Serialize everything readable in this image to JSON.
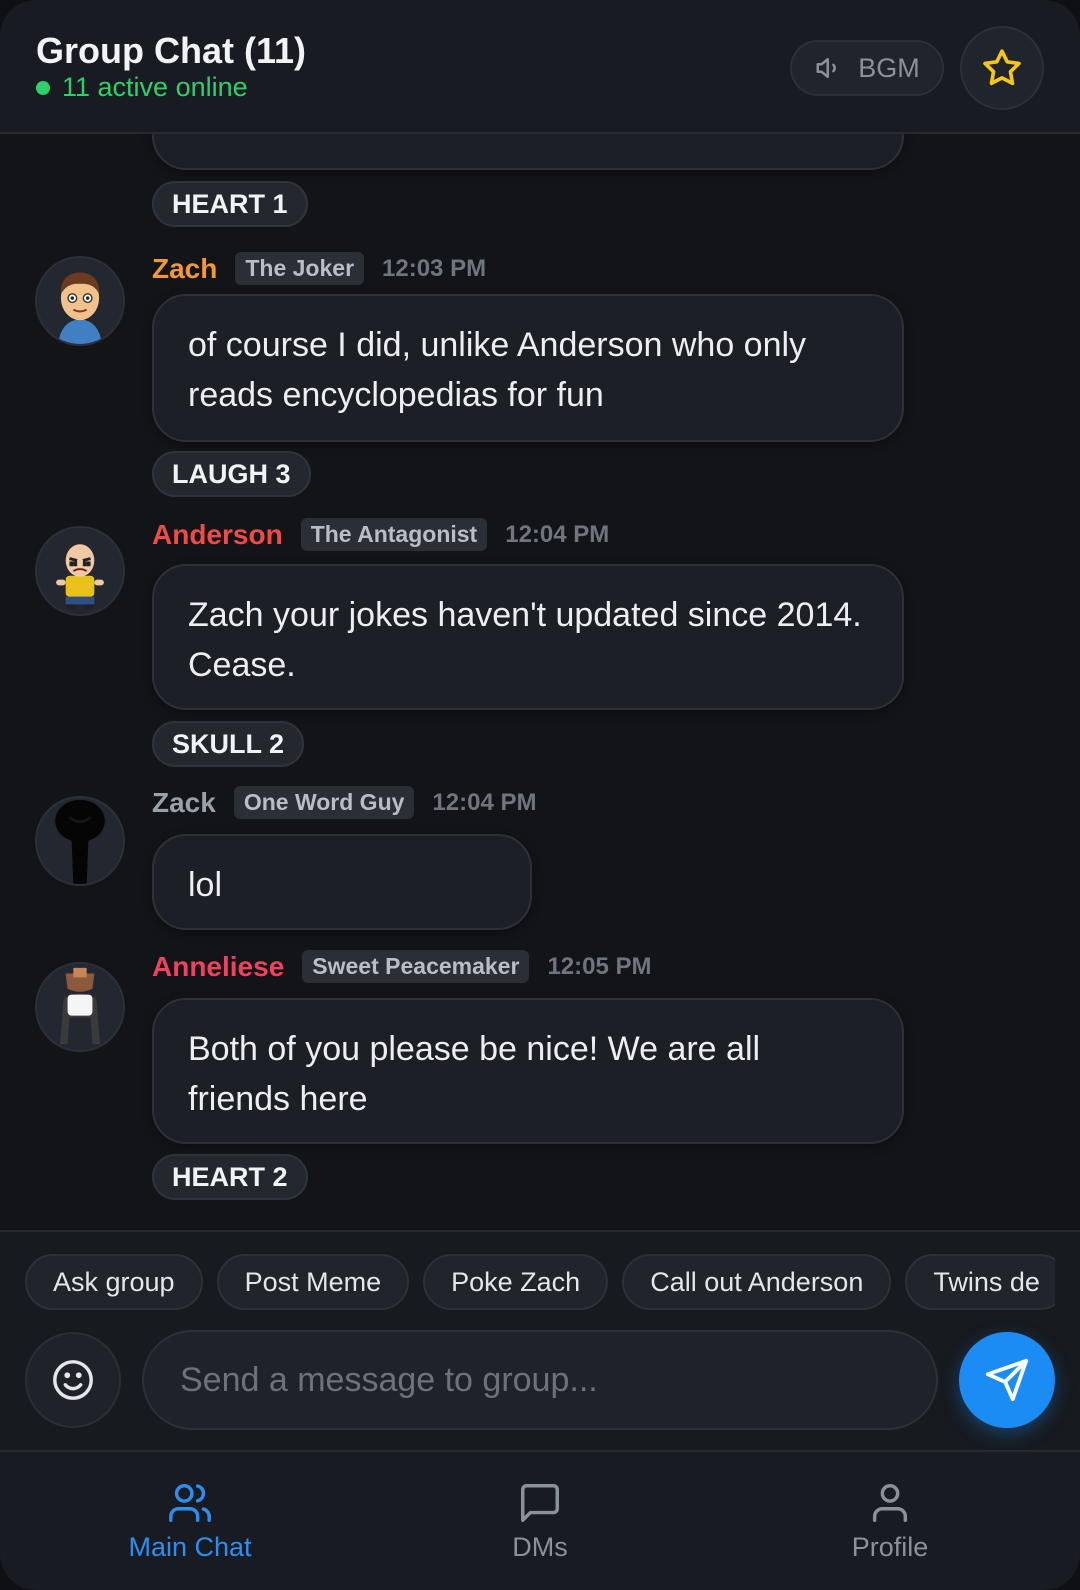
{
  "header": {
    "title": "Group Chat (11)",
    "status": "11 active online",
    "bgm_label": "BGM"
  },
  "top_reaction": {
    "label": "HEART 1"
  },
  "messages": [
    {
      "name": "Zach",
      "name_color": "#f59a2a",
      "role": "The Joker",
      "time": "12:03 PM",
      "text": "of course I did, unlike Anderson who only reads encyclopedias for fun",
      "reaction": "LAUGH 3"
    },
    {
      "name": "Anderson",
      "name_color": "#ef4b47",
      "role": "The Antagonist",
      "time": "12:04 PM",
      "text": "Zach your jokes haven't updated since 2014. Cease.",
      "reaction": "SKULL 2"
    },
    {
      "name": "Zack",
      "name_color": "#9aa0a8",
      "role": "One Word Guy",
      "time": "12:04 PM",
      "text": "lol",
      "reaction": null
    },
    {
      "name": "Anneliese",
      "name_color": "#f0415f",
      "role": "Sweet Peacemaker",
      "time": "12:05 PM",
      "text": "Both of you please be nice! We are all friends here",
      "reaction": "HEART 2"
    }
  ],
  "quick_actions": [
    "Ask group",
    "Post Meme",
    "Poke Zach",
    "Call out Anderson",
    "Twins de"
  ],
  "composer": {
    "placeholder": "Send a message to group...",
    "value": ""
  },
  "nav": {
    "items": [
      {
        "label": "Main Chat",
        "icon": "users-icon",
        "active": true
      },
      {
        "label": "DMs",
        "icon": "message-square-icon",
        "active": false
      },
      {
        "label": "Profile",
        "icon": "user-icon",
        "active": false
      }
    ]
  },
  "colors": {
    "accent": "#2d8ef0",
    "online": "#2fd06a",
    "star": "#f5c518",
    "send": "#1c8cf5"
  }
}
